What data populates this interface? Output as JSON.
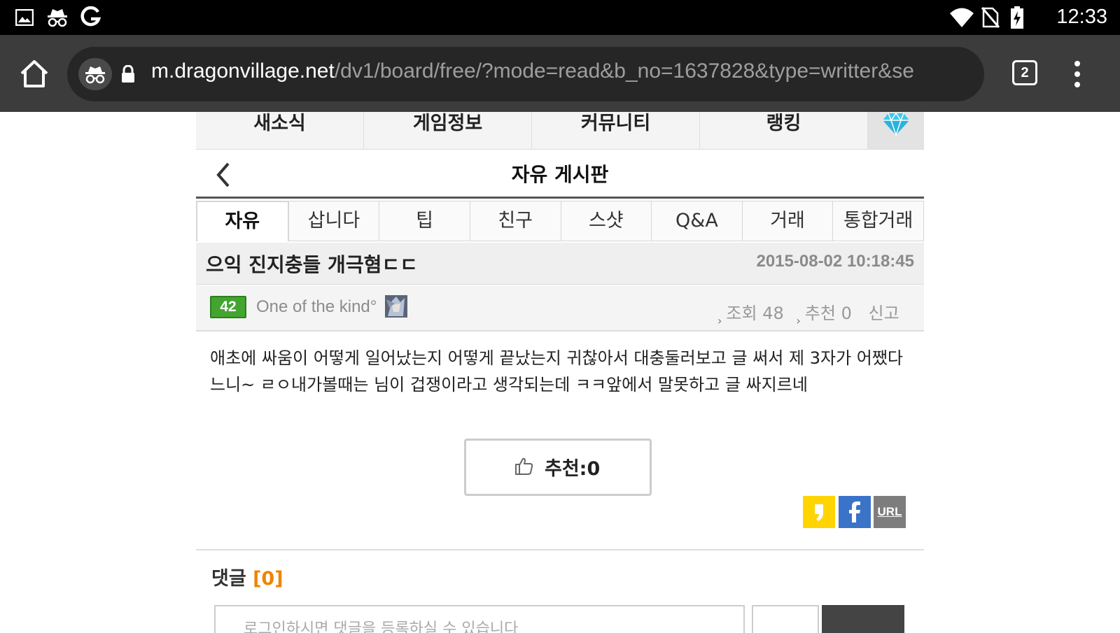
{
  "status_bar": {
    "time": "12:33",
    "left_icons": [
      "gallery-icon",
      "incognito-icon",
      "google-icon"
    ],
    "right_icons": [
      "wifi-icon",
      "no-sim-icon",
      "battery-charging-icon"
    ]
  },
  "browser": {
    "url_host": "m.dragonvillage.net",
    "url_path": "/dv1/board/free/?mode=read&b_no=1637828&type=writter&se",
    "tab_count": "2"
  },
  "top_nav": {
    "items": [
      "새소식",
      "게임정보",
      "커뮤니티",
      "랭킹"
    ],
    "gem_icon": "diamond-icon"
  },
  "board": {
    "title": "자유 게시판",
    "categories": [
      "자유",
      "삽니다",
      "팁",
      "친구",
      "스샷",
      "Q&A",
      "거래",
      "통합거래"
    ],
    "active_category": "자유"
  },
  "post": {
    "title": "으익 진지충들 개극혐ㄷㄷ",
    "date": "2015-08-02 10:18:45",
    "level": "42",
    "writer": "One of the kind°",
    "views": "조회 48",
    "recommends": "추천 0",
    "report": "신고",
    "body_line1": "애초에 싸움이 어떻게 일어났는지 어떻게 끝났는지 귀찮아서 대충둘러보고 글 써서 제 3자가 어쨌다",
    "body_line2": "느니~ ㄹㅇ내가볼때는 님이 겁쟁이라고 생각되는데 ㅋㅋ앞에서 말못하고 글 싸지르네",
    "recommend_button": "추천:0"
  },
  "share": {
    "kakao": "",
    "facebook": "f",
    "url": "URL",
    "colors": {
      "kakao": "#ffd400",
      "facebook": "#3b73c9",
      "url": "#7d7d7d"
    }
  },
  "comments": {
    "label": "댓글",
    "count": "[0]",
    "count_color": "#f08400",
    "placeholder": "로그인하시면 댓글을 등록하실 수 있습니다"
  }
}
